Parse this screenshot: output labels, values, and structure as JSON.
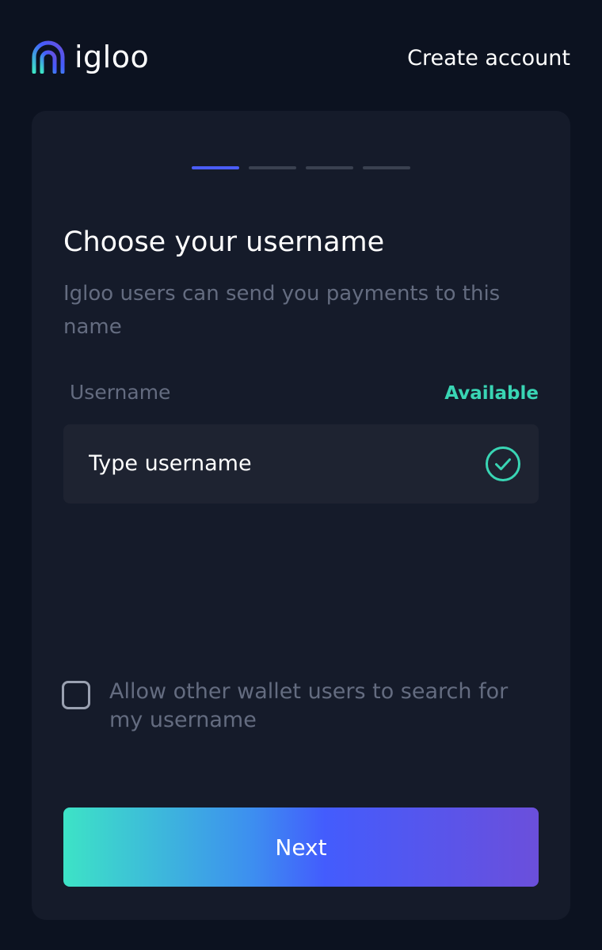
{
  "header": {
    "brand_name": "igloo",
    "create_account_link": "Create account"
  },
  "stepper": {
    "total_steps": 4,
    "current_step": 1
  },
  "form": {
    "title": "Choose your username",
    "subtitle": "Igloo users can send you payments to this name",
    "username_label": "Username",
    "availability_status": "Available",
    "username_value": "Type username",
    "search_consent_label": "Allow other wallet users to search for my username",
    "search_consent_checked": false,
    "next_button_label": "Next"
  },
  "colors": {
    "background": "#0c1220",
    "card": "#151b2a",
    "input": "#1e2331",
    "accent_blue": "#4a5df8",
    "available_green": "#39d5b4",
    "muted_text": "#646c80"
  },
  "icons": {
    "brand": "igloo-logo-icon",
    "status": "check-circle-icon",
    "consent": "checkbox-icon"
  }
}
